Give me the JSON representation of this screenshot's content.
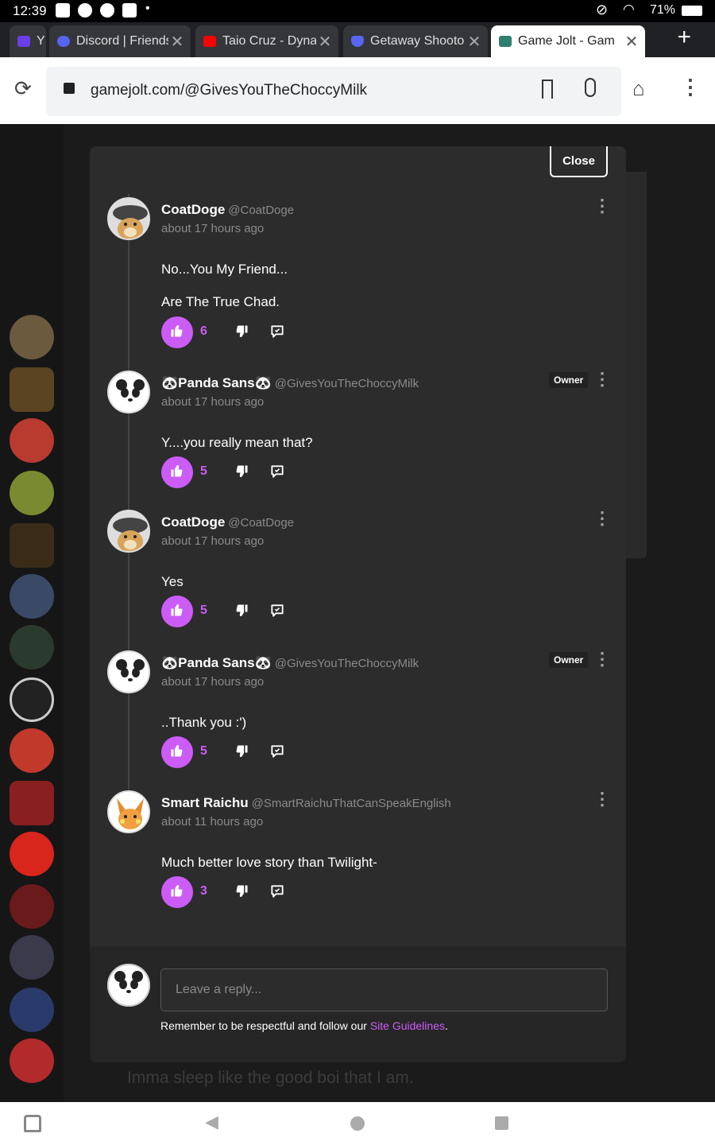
{
  "status": {
    "time": "12:39",
    "battery": "71%"
  },
  "tabs": [
    {
      "label": "Y",
      "favicon_color": "#6a3ee8"
    },
    {
      "label": "Discord | Friends",
      "favicon_color": "#5865f2"
    },
    {
      "label": "Taio Cruz - Dyna",
      "favicon_color": "#ff0000"
    },
    {
      "label": "Getaway Shooto",
      "favicon_color": "#5865f2"
    },
    {
      "label": "Game Jolt - Gam",
      "favicon_color": "#2f7f6f"
    }
  ],
  "url": "gamejolt.com/@GivesYouTheChoccyMilk",
  "modal": {
    "close_label": "Close",
    "comments": [
      {
        "name": "CoatDoge",
        "handle": "@CoatDoge",
        "time": "about 17 hours ago",
        "owner": false,
        "lines": [
          "No...You My Friend...",
          "Are The True Chad."
        ],
        "likes": "6",
        "avatar": "doge"
      },
      {
        "name": "🐼Panda Sans🐼",
        "handle": "@GivesYouTheChoccyMilk",
        "time": "about 17 hours ago",
        "owner": true,
        "owner_label": "Owner",
        "lines": [
          "Y....you really mean that?"
        ],
        "likes": "5",
        "avatar": "panda"
      },
      {
        "name": "CoatDoge",
        "handle": "@CoatDoge",
        "time": "about 17 hours ago",
        "owner": false,
        "lines": [
          "Yes"
        ],
        "likes": "5",
        "avatar": "doge"
      },
      {
        "name": "🐼Panda Sans🐼",
        "handle": "@GivesYouTheChoccyMilk",
        "time": "about 17 hours ago",
        "owner": true,
        "owner_label": "Owner",
        "lines": [
          "..Thank you :')"
        ],
        "likes": "5",
        "avatar": "panda"
      },
      {
        "name": "Smart Raichu",
        "handle": "@SmartRaichuThatCanSpeakEnglish",
        "time": "about 11 hours ago",
        "owner": false,
        "lines": [
          "Much better love story than Twilight-"
        ],
        "likes": "3",
        "avatar": "raichu"
      }
    ],
    "reply_placeholder": "Leave a reply...",
    "guidelines_prefix": "Remember to be respectful and follow our ",
    "guidelines_link": "Site Guidelines",
    "guidelines_suffix": "."
  },
  "background_text": "Imma sleep like the good boi that I am.",
  "accent_color": "#cc5cf6"
}
